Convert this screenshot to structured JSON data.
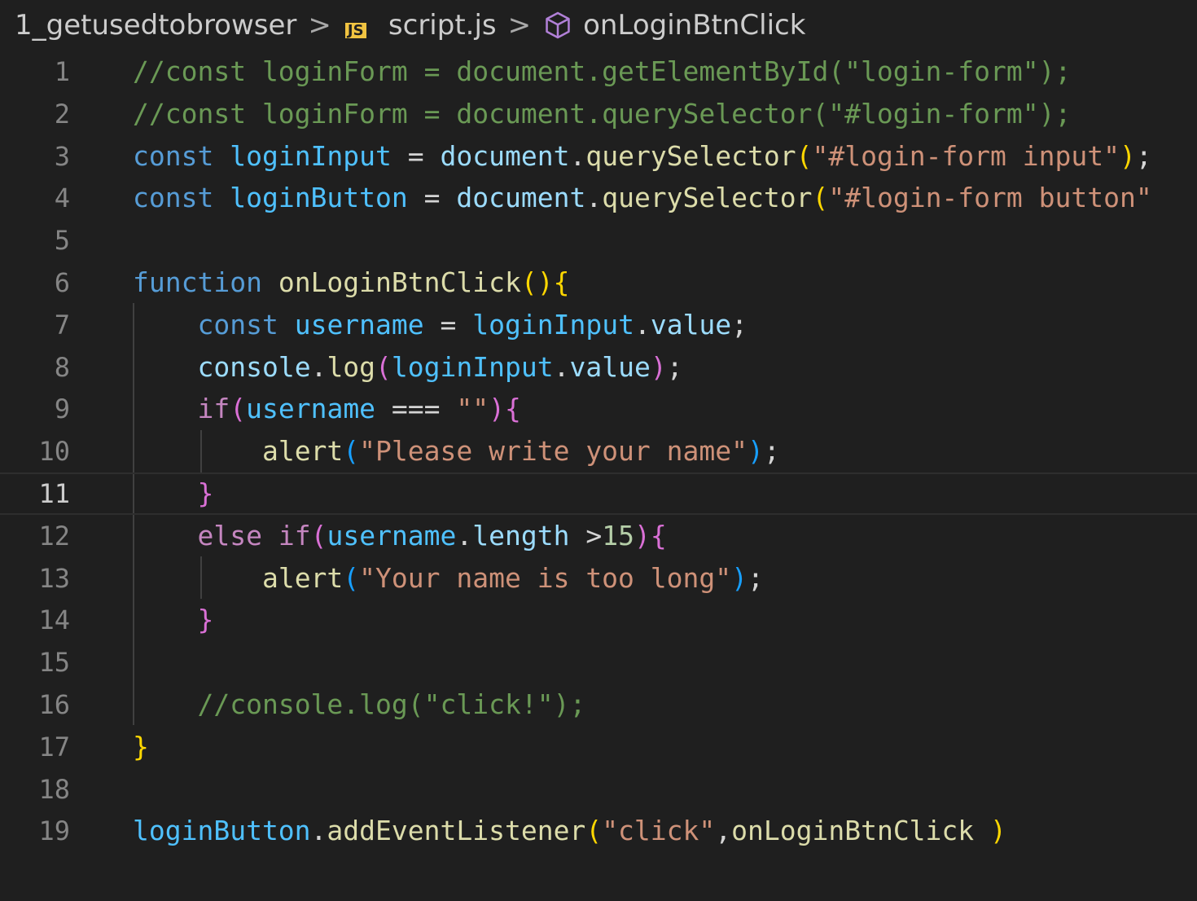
{
  "breadcrumb": {
    "folder": "1_getusedtobrowser",
    "file": "script.js",
    "file_icon": "js-file-icon",
    "symbol": "onLoginBtnClick",
    "symbol_icon": "method-cube-icon",
    "separator": ">"
  },
  "editor": {
    "active_line": 11,
    "lines": [
      {
        "n": "1",
        "tokens": [
          [
            "c-com",
            "//const loginForm = document.getElementById(\"login-form\");"
          ]
        ]
      },
      {
        "n": "2",
        "tokens": [
          [
            "c-com",
            "//const loginForm = document.querySelector(\"#login-form\");"
          ]
        ]
      },
      {
        "n": "3",
        "tokens": [
          [
            "c-kw",
            "const"
          ],
          [
            "c-op",
            " "
          ],
          [
            "c-const",
            "loginInput"
          ],
          [
            "c-op",
            " = "
          ],
          [
            "c-var",
            "document"
          ],
          [
            "c-op",
            "."
          ],
          [
            "c-fn",
            "querySelector"
          ],
          [
            "b1",
            "("
          ],
          [
            "c-str",
            "\"#login-form input\""
          ],
          [
            "b1",
            ")"
          ],
          [
            "c-op",
            ";"
          ]
        ]
      },
      {
        "n": "4",
        "tokens": [
          [
            "c-kw",
            "const"
          ],
          [
            "c-op",
            " "
          ],
          [
            "c-const",
            "loginButton"
          ],
          [
            "c-op",
            " = "
          ],
          [
            "c-var",
            "document"
          ],
          [
            "c-op",
            "."
          ],
          [
            "c-fn",
            "querySelector"
          ],
          [
            "b1",
            "("
          ],
          [
            "c-str",
            "\"#login-form button\""
          ]
        ]
      },
      {
        "n": "5",
        "tokens": []
      },
      {
        "n": "6",
        "tokens": [
          [
            "c-kw",
            "function"
          ],
          [
            "c-op",
            " "
          ],
          [
            "c-fn",
            "onLoginBtnClick"
          ],
          [
            "b1",
            "()"
          ],
          [
            "b1",
            "{"
          ]
        ]
      },
      {
        "n": "7",
        "tokens": [
          [
            "c-op",
            "    "
          ],
          [
            "c-kw",
            "const"
          ],
          [
            "c-op",
            " "
          ],
          [
            "c-const",
            "username"
          ],
          [
            "c-op",
            " = "
          ],
          [
            "c-const",
            "loginInput"
          ],
          [
            "c-op",
            "."
          ],
          [
            "c-var",
            "value"
          ],
          [
            "c-op",
            ";"
          ]
        ]
      },
      {
        "n": "8",
        "tokens": [
          [
            "c-op",
            "    "
          ],
          [
            "c-var",
            "console"
          ],
          [
            "c-op",
            "."
          ],
          [
            "c-fn",
            "log"
          ],
          [
            "b2",
            "("
          ],
          [
            "c-const",
            "loginInput"
          ],
          [
            "c-op",
            "."
          ],
          [
            "c-var",
            "value"
          ],
          [
            "b2",
            ")"
          ],
          [
            "c-op",
            ";"
          ]
        ]
      },
      {
        "n": "9",
        "tokens": [
          [
            "c-op",
            "    "
          ],
          [
            "c-ctrl",
            "if"
          ],
          [
            "b2",
            "("
          ],
          [
            "c-const",
            "username"
          ],
          [
            "c-op",
            " === "
          ],
          [
            "c-str",
            "\"\""
          ],
          [
            "b2",
            ")"
          ],
          [
            "b2",
            "{"
          ]
        ]
      },
      {
        "n": "10",
        "tokens": [
          [
            "c-op",
            "        "
          ],
          [
            "c-fn",
            "alert"
          ],
          [
            "b3",
            "("
          ],
          [
            "c-str",
            "\"Please write your name\""
          ],
          [
            "b3",
            ")"
          ],
          [
            "c-op",
            ";"
          ]
        ]
      },
      {
        "n": "11",
        "tokens": [
          [
            "c-op",
            "    "
          ],
          [
            "b2",
            "}"
          ]
        ]
      },
      {
        "n": "12",
        "tokens": [
          [
            "c-op",
            "    "
          ],
          [
            "c-ctrl",
            "else"
          ],
          [
            "c-op",
            " "
          ],
          [
            "c-ctrl",
            "if"
          ],
          [
            "b2",
            "("
          ],
          [
            "c-const",
            "username"
          ],
          [
            "c-op",
            "."
          ],
          [
            "c-var",
            "length"
          ],
          [
            "c-op",
            " >"
          ],
          [
            "c-num",
            "15"
          ],
          [
            "b2",
            ")"
          ],
          [
            "b2",
            "{"
          ]
        ]
      },
      {
        "n": "13",
        "tokens": [
          [
            "c-op",
            "        "
          ],
          [
            "c-fn",
            "alert"
          ],
          [
            "b3",
            "("
          ],
          [
            "c-str",
            "\"Your name is too long\""
          ],
          [
            "b3",
            ")"
          ],
          [
            "c-op",
            ";"
          ]
        ]
      },
      {
        "n": "14",
        "tokens": [
          [
            "c-op",
            "    "
          ],
          [
            "b2",
            "}"
          ]
        ]
      },
      {
        "n": "15",
        "tokens": []
      },
      {
        "n": "16",
        "tokens": [
          [
            "c-op",
            "    "
          ],
          [
            "c-com",
            "//console.log(\"click!\");"
          ]
        ]
      },
      {
        "n": "17",
        "tokens": [
          [
            "b1",
            "}"
          ]
        ]
      },
      {
        "n": "18",
        "tokens": []
      },
      {
        "n": "19",
        "tokens": [
          [
            "c-const",
            "loginButton"
          ],
          [
            "c-op",
            "."
          ],
          [
            "c-fn",
            "addEventListener"
          ],
          [
            "b1",
            "("
          ],
          [
            "c-str",
            "\"click\""
          ],
          [
            "c-op",
            ","
          ],
          [
            "c-fn",
            "onLoginBtnClick"
          ],
          [
            "c-op",
            " "
          ],
          [
            "b1",
            ")"
          ]
        ]
      }
    ]
  }
}
